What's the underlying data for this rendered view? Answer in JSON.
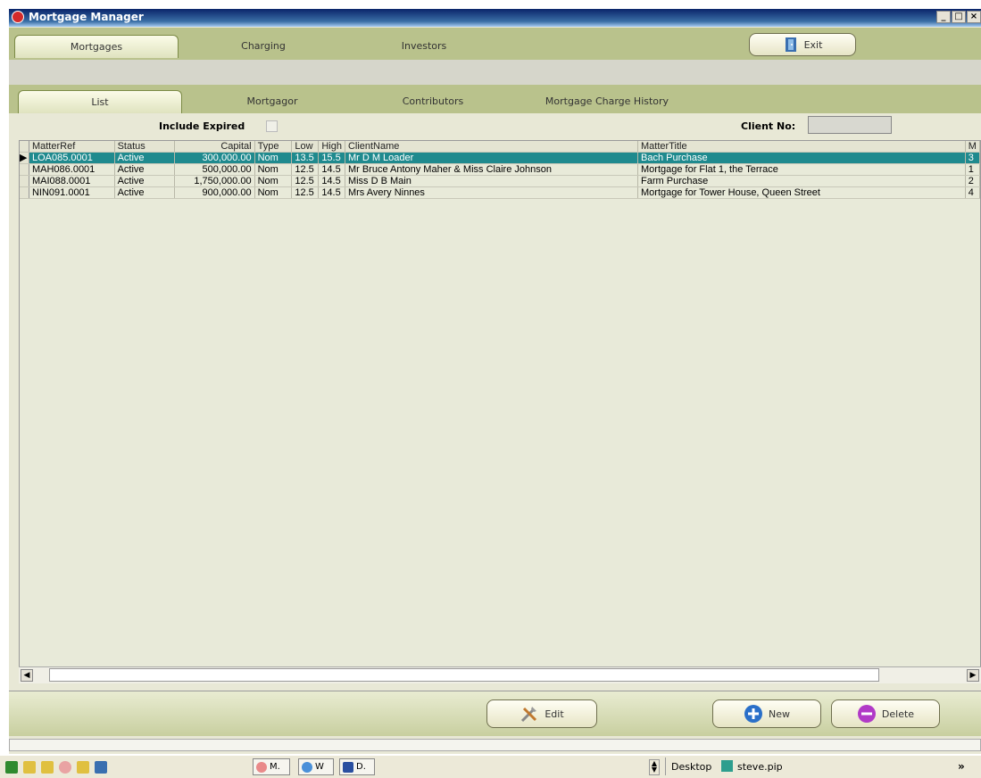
{
  "window": {
    "title": "Mortgage Manager",
    "min": "_",
    "max": "□",
    "close": "×"
  },
  "main_tabs": [
    {
      "label": "Mortgages",
      "active": true
    },
    {
      "label": "Charging",
      "active": false
    },
    {
      "label": "Investors",
      "active": false
    }
  ],
  "exit_label": "Exit",
  "sub_tabs": [
    {
      "label": "List",
      "active": true
    },
    {
      "label": "Mortgagor",
      "active": false
    },
    {
      "label": "Contributors",
      "active": false
    },
    {
      "label": "Mortgage Charge History",
      "active": false
    }
  ],
  "filters": {
    "include_expired_label": "Include Expired",
    "client_no_label": "Client No:",
    "client_no_value": ""
  },
  "grid": {
    "columns": [
      "MatterRef",
      "Status",
      "Capital",
      "Type",
      "Low",
      "High",
      "ClientName",
      "MatterTitle",
      "M"
    ],
    "rows": [
      {
        "cells": [
          "LOA085.0001",
          "Active",
          "300,000.00",
          "Nom",
          "13.5",
          "15.5",
          "Mr D M Loader",
          "Bach Purchase",
          "3"
        ],
        "selected": true
      },
      {
        "cells": [
          "MAH086.0001",
          "Active",
          "500,000.00",
          "Nom",
          "12.5",
          "14.5",
          "Mr Bruce Antony Maher & Miss Claire Johnson",
          "Mortgage for Flat 1, the Terrace",
          "1"
        ],
        "selected": false
      },
      {
        "cells": [
          "MAI088.0001",
          "Active",
          "1,750,000.00",
          "Nom",
          "12.5",
          "14.5",
          "Miss D B Main",
          "Farm Purchase",
          "2"
        ],
        "selected": false
      },
      {
        "cells": [
          "NIN091.0001",
          "Active",
          "900,000.00",
          "Nom",
          "12.5",
          "14.5",
          "Mrs Avery Ninnes",
          "Mortgage for Tower House, Queen Street",
          "4"
        ],
        "selected": false
      }
    ],
    "selected_indicator": "▶"
  },
  "scroll": {
    "left": "◀",
    "right": "▶"
  },
  "buttons": {
    "edit": "Edit",
    "new": "New",
    "delete": "Delete"
  },
  "taskbar": {
    "tasks": [
      "M.",
      "W",
      "D."
    ],
    "desktop": "Desktop",
    "file": "steve.pip",
    "chevron": "»"
  },
  "colors": {
    "accent": "#b9c28c",
    "selection": "#1f8a8e"
  }
}
